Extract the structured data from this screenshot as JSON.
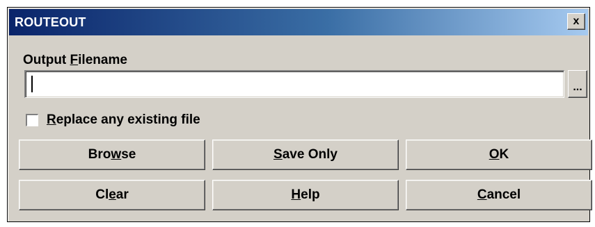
{
  "window": {
    "title": "ROUTEOUT",
    "close_glyph": "x"
  },
  "output": {
    "label_pre": "Output ",
    "label_key": "F",
    "label_post": "ilename",
    "filename_value": "",
    "browse_small_label": "..."
  },
  "replace": {
    "checked": false,
    "label_key": "R",
    "label_post": "eplace any existing file"
  },
  "buttons": {
    "browse": {
      "pre": "Bro",
      "key": "w",
      "post": "se"
    },
    "save_only": {
      "pre": "",
      "key": "S",
      "post": "ave Only"
    },
    "ok": {
      "pre": "",
      "key": "O",
      "post": "K"
    },
    "clear": {
      "pre": "Cl",
      "key": "e",
      "post": "ar"
    },
    "help": {
      "pre": "",
      "key": "H",
      "post": "elp"
    },
    "cancel": {
      "pre": "",
      "key": "C",
      "post": "ancel"
    }
  },
  "colors": {
    "titlebar_start": "#0a246a",
    "titlebar_end": "#a6caf0",
    "face": "#d4d0c8"
  }
}
